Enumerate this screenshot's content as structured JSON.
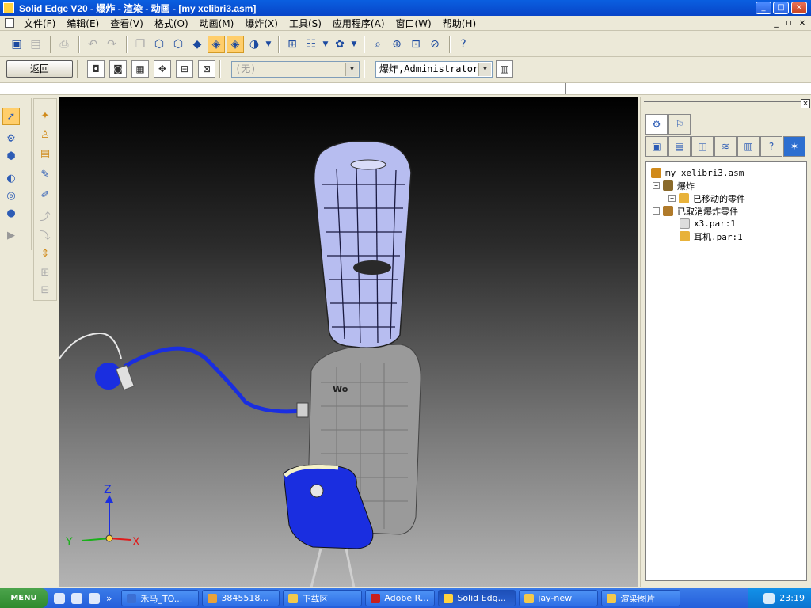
{
  "window": {
    "title": "Solid Edge V20 - 爆炸 - 渲染 - 动画 - [my xelibri3.asm]",
    "controls": {
      "minimize": "_",
      "maximize": "□",
      "close": "×"
    }
  },
  "menubar": {
    "items": [
      "文件(F)",
      "编辑(E)",
      "查看(V)",
      "格式(O)",
      "动画(M)",
      "爆炸(X)",
      "工具(S)",
      "应用程序(A)",
      "窗口(W)",
      "帮助(H)"
    ],
    "mdi_controls": {
      "minimize": "_",
      "restore": "▫",
      "close": "×"
    }
  },
  "toolbar2": {
    "back_label": "返回",
    "style_combo_value": "(无)",
    "config_combo_value": "爆炸,Administrator"
  },
  "viewport": {
    "axes": {
      "z": "Z",
      "y": "Y",
      "x": "X"
    },
    "colors": {
      "blue_part": "#1a2ee0",
      "gray_shell": "#9a9a9a",
      "cover": "#b7bdf0"
    }
  },
  "panel": {
    "close_label": "×",
    "tree": [
      {
        "label": "my xelibri3.asm",
        "icon": "assembly-icon"
      },
      {
        "label": "爆炸",
        "icon": "explode-icon",
        "expander": "−"
      },
      {
        "label": "已移动的零件",
        "icon": "part-group-icon",
        "expander": "+"
      },
      {
        "label": "已取消爆炸零件",
        "icon": "unexplode-icon",
        "expander": "−"
      },
      {
        "label": "x3.par:1",
        "icon": "part-icon"
      },
      {
        "label": "耳机.par:1",
        "icon": "earphone-part-icon"
      }
    ]
  },
  "taskbar": {
    "start_label": "MENU",
    "more_label": "»",
    "tasks": [
      {
        "label": "禾马_TO...",
        "color": "#3b6fd4"
      },
      {
        "label": "3845518...",
        "color": "#e8a23a"
      },
      {
        "label": "下载区",
        "color": "#f2c94c"
      },
      {
        "label": "Adobe R...",
        "color": "#c8201e"
      },
      {
        "label": "Solid Edg...",
        "color": "#ffd23f"
      },
      {
        "label": "jay-new",
        "color": "#f2c94c"
      },
      {
        "label": "渲染图片",
        "color": "#f2c94c"
      }
    ],
    "clock": "23:19"
  }
}
